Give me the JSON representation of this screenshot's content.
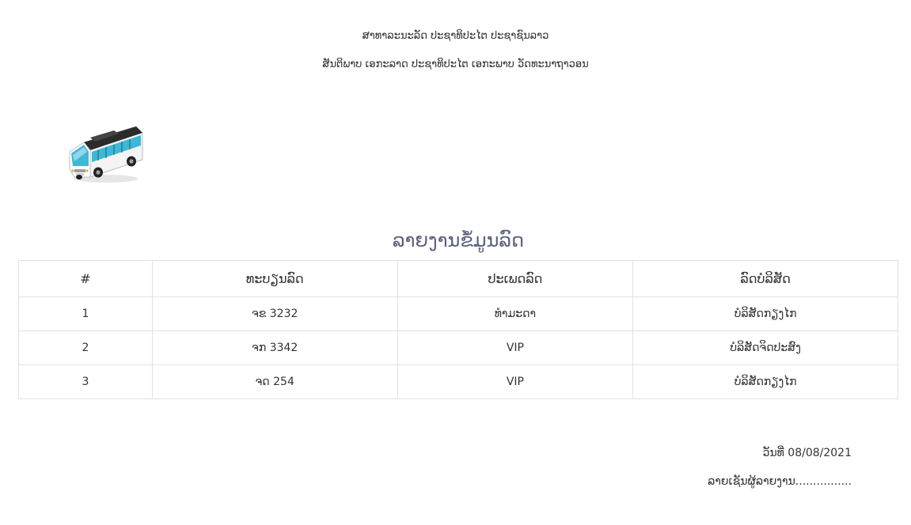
{
  "header": {
    "line1": "ສາທາລະນະລັດ ປະຊາທິປະໄຕ ປະຊາຊົນລາວ",
    "line2": "ສັນຕິພາບ ເອກະລາດ ປະຊາທິປະໄຕ ເອກະພາບ ວັດທະນາຖາວອນ"
  },
  "logo": {
    "icon": "bus-icon",
    "colors": {
      "body": "#ffffff",
      "roof": "#2b2b2b",
      "window": "#3fb7d6"
    }
  },
  "report": {
    "title": "ລາຍງານຂໍ້ມູນລົດ",
    "columns": [
      "#",
      "ທະບຽນລົດ",
      "ປະເພດລົດ",
      "ລົດບໍລິສັດ"
    ],
    "rows": [
      [
        "1",
        "ຈຂ 3232",
        "ທຳມະດາ",
        "ບໍລິສັດກຽງໄກ"
      ],
      [
        "2",
        "ຈກ 3342",
        "VIP",
        "ບໍລິສັດຈິດປະສົງ"
      ],
      [
        "3",
        "ຈດ 254",
        "VIP",
        "ບໍລິສັດກຽງໄກ"
      ]
    ]
  },
  "footer": {
    "date_text": "ວັນທີ່ 08/08/2021",
    "signature_text": "ລາຍເຊັນຜູ້ລາຍງານ................"
  }
}
